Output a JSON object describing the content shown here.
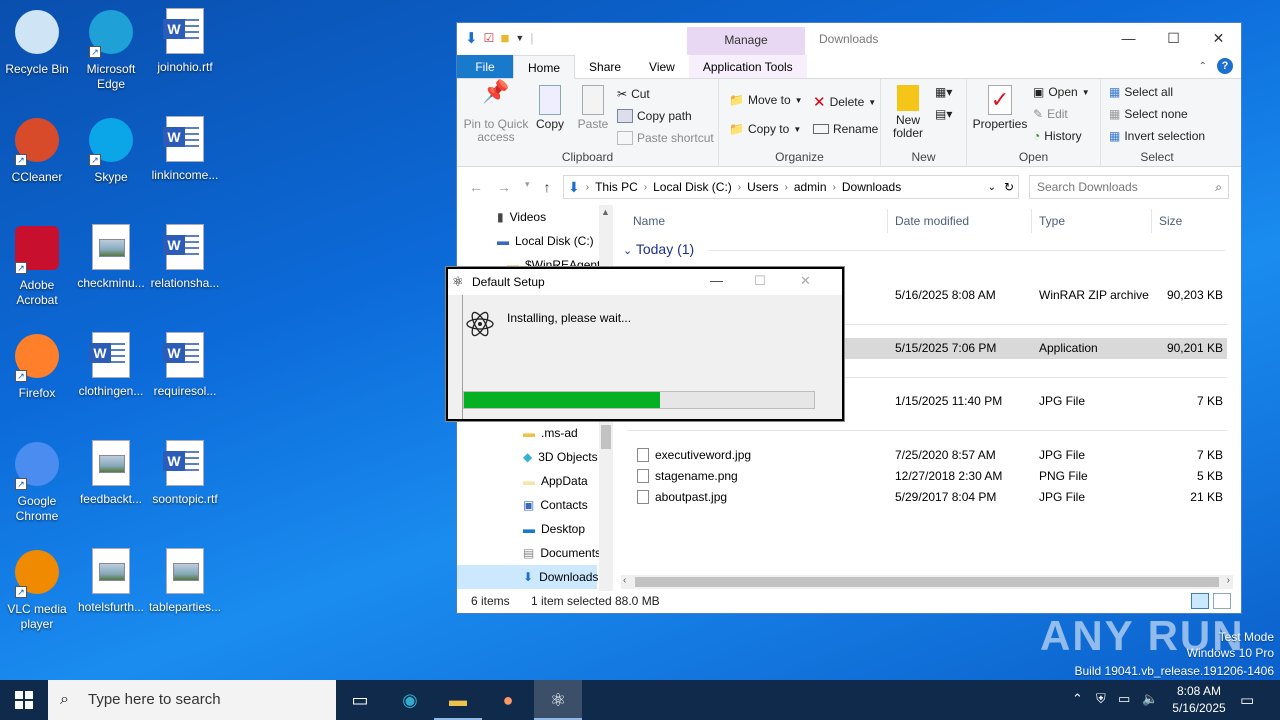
{
  "desktop": {
    "icons": [
      {
        "label": "Recycle Bin",
        "icon": "recycle-bin-icon"
      },
      {
        "label": "Microsoft Edge",
        "icon": "edge-icon"
      },
      {
        "label": "joinohio.rtf",
        "icon": "word-doc-icon"
      },
      {
        "label": "CCleaner",
        "icon": "ccleaner-icon"
      },
      {
        "label": "Skype",
        "icon": "skype-icon"
      },
      {
        "label": "linkincome...",
        "icon": "word-doc-icon"
      },
      {
        "label": "Adobe Acrobat",
        "icon": "acrobat-icon"
      },
      {
        "label": "checkminu...",
        "icon": "image-file-icon"
      },
      {
        "label": "relationsha...",
        "icon": "word-doc-icon"
      },
      {
        "label": "Firefox",
        "icon": "firefox-icon"
      },
      {
        "label": "clothingen...",
        "icon": "word-doc-icon"
      },
      {
        "label": "requiresol...",
        "icon": "word-doc-icon"
      },
      {
        "label": "Google Chrome",
        "icon": "chrome-icon"
      },
      {
        "label": "feedbackt...",
        "icon": "image-file-icon"
      },
      {
        "label": "soontopic.rtf",
        "icon": "word-doc-icon"
      },
      {
        "label": "VLC media player",
        "icon": "vlc-icon"
      },
      {
        "label": "hotelsfurth...",
        "icon": "image-file-icon"
      },
      {
        "label": "tableparties...",
        "icon": "image-file-icon"
      }
    ]
  },
  "explorer": {
    "title": "Downloads",
    "contextual_tab": "Manage",
    "tabs": {
      "file": "File",
      "home": "Home",
      "share": "Share",
      "view": "View",
      "app_tools": "Application Tools"
    },
    "ribbon": {
      "clipboard": {
        "name": "Clipboard",
        "pin": "Pin to Quick access",
        "copy": "Copy",
        "paste": "Paste",
        "cut": "Cut",
        "copy_path": "Copy path",
        "paste_shortcut": "Paste shortcut"
      },
      "organize": {
        "name": "Organize",
        "move_to": "Move to",
        "copy_to": "Copy to",
        "delete": "Delete",
        "rename": "Rename"
      },
      "new": {
        "name": "New",
        "new_folder": "New folder"
      },
      "open": {
        "name": "Open",
        "properties": "Properties",
        "open": "Open",
        "edit": "Edit",
        "history": "History"
      },
      "select": {
        "name": "Select",
        "select_all": "Select all",
        "select_none": "Select none",
        "invert": "Invert selection"
      }
    },
    "address": {
      "parts": [
        "This PC",
        "Local Disk (C:)",
        "Users",
        "admin",
        "Downloads"
      ]
    },
    "search_placeholder": "Search Downloads",
    "nav": [
      "Videos",
      "Local Disk (C:)",
      "$WinREAgent",
      ".ms-ad",
      "3D Objects",
      "AppData",
      "Contacts",
      "Desktop",
      "Documents",
      "Downloads"
    ],
    "columns": {
      "name": "Name",
      "date": "Date modified",
      "type": "Type",
      "size": "Size"
    },
    "group_today": "Today (1)",
    "files": [
      {
        "name": "",
        "date": "5/16/2025 8:08 AM",
        "type": "WinRAR ZIP archive",
        "size": "90,203 KB"
      },
      {
        "name": "",
        "date": "5/15/2025 7:06 PM",
        "type": "Application",
        "size": "90,201 KB"
      },
      {
        "name": "",
        "date": "1/15/2025 11:40 PM",
        "type": "JPG File",
        "size": "7 KB"
      },
      {
        "name": "executiveword.jpg",
        "date": "7/25/2020 8:57 AM",
        "type": "JPG File",
        "size": "7 KB"
      },
      {
        "name": "stagename.png",
        "date": "12/27/2018 2:30 AM",
        "type": "PNG File",
        "size": "5 KB"
      },
      {
        "name": "aboutpast.jpg",
        "date": "5/29/2017 8:04 PM",
        "type": "JPG File",
        "size": "21 KB"
      }
    ],
    "status": {
      "count": "6 items",
      "selected": "1 item selected",
      "size": "88.0 MB"
    }
  },
  "setup": {
    "title": "Default Setup",
    "message": "Installing, please wait...",
    "progress": 0.56,
    "progress_color": "#06b025"
  },
  "taskbar": {
    "search_placeholder": "Type here to search",
    "time": "8:08 AM",
    "date": "5/16/2025"
  },
  "watermark": {
    "brand": "ANY RUN",
    "mode": "Test Mode",
    "os": "Windows 10 Pro",
    "build": "Build 19041.vb_release.191206-1406"
  }
}
